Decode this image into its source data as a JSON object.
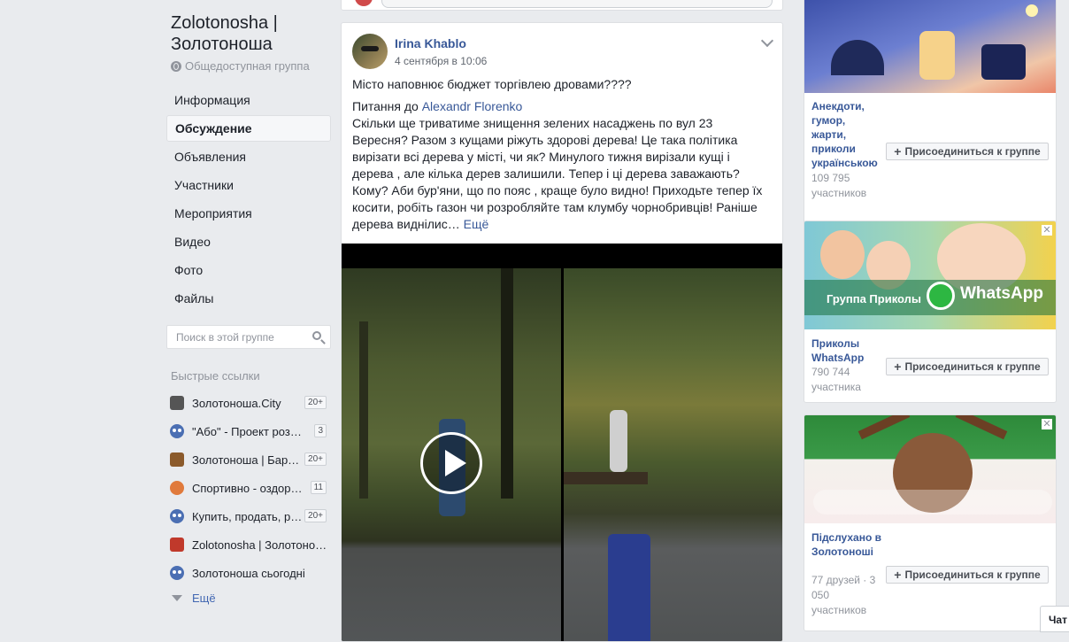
{
  "group": {
    "title": "Zolotonosha | Золотоноша",
    "privacy": "Общедоступная группа"
  },
  "nav": {
    "items": [
      {
        "label": "Информация",
        "active": false
      },
      {
        "label": "Обсуждение",
        "active": true
      },
      {
        "label": "Объявления",
        "active": false
      },
      {
        "label": "Участники",
        "active": false
      },
      {
        "label": "Мероприятия",
        "active": false
      },
      {
        "label": "Видео",
        "active": false
      },
      {
        "label": "Фото",
        "active": false
      },
      {
        "label": "Файлы",
        "active": false
      }
    ]
  },
  "search": {
    "placeholder": "Поиск в этой группе"
  },
  "quick_links": {
    "heading": "Быстрые ссылки",
    "items": [
      {
        "label": "Золотоноша.City",
        "badge": "20+",
        "icon": "city-icon",
        "icon_color": "#555555"
      },
      {
        "label": "\"Або\" - Проект розв…",
        "badge": "3",
        "icon": "group-icon",
        "icon_color": "#4b6fb3"
      },
      {
        "label": "Золотоноша | Бар…",
        "badge": "20+",
        "icon": "briefcase-icon",
        "icon_color": "#8b5a2b"
      },
      {
        "label": "Спортивно - оздоро…",
        "badge": "11",
        "icon": "ball-icon",
        "icon_color": "#e07a3c"
      },
      {
        "label": "Купить, продать, р…",
        "badge": "20+",
        "icon": "group-icon",
        "icon_color": "#4b6fb3"
      },
      {
        "label": "Zolotonosha | Золотоно…",
        "badge": "",
        "icon": "house-icon",
        "icon_color": "#c0392b"
      },
      {
        "label": "Золотоноша сьогодні",
        "badge": "",
        "icon": "group-icon",
        "icon_color": "#4b6fb3"
      }
    ],
    "more_label": "Ещё"
  },
  "post": {
    "author": "Irina Khablo",
    "timestamp": "4 сентября в 10:06",
    "line1": "Місто наповнює бюджет торгівлею дровами????",
    "line2_prefix": "Питання до ",
    "line2_mention": "Alexandr Florenko",
    "body": "Скільки ще триватиме знищення зелених насаджень по вул 23 Вересня? Разом з кущами ріжуть здорові дерева! Це така політика вирізати всі дерева у місті, чи як? Минулого тижня вирізали кущі і дерева , але кілька дерев залишили. Тепер і ці дерева заважають? Кому? Аби бур'яни, що по пояс , краще було видно! Приходьте тепер їх косити, робіть газон чи розробляйте там клумбу чорнобривців! Раніше дерева виднілис…",
    "see_more": "Ещё"
  },
  "ads": [
    {
      "name": "Анекдоти, гумор, жарти, приколи українською",
      "meta": "109 795 участников",
      "join": "Присоединиться к группе"
    },
    {
      "name": "Приколы WhatsApp",
      "meta": "790 744 участника",
      "join": "Присоединиться к группе",
      "banner_left": "Группа Приколы",
      "banner_right": "WhatsApp"
    },
    {
      "name": "Підслухано в Золотоноші",
      "meta": "77 друзей · 3 050 участников",
      "join": "Присоединиться к группе"
    }
  ],
  "chat": {
    "label": "Чат"
  },
  "colors": {
    "background": "#e9ebee",
    "link": "#385898",
    "accent": "#4267b2",
    "whatsapp_green": "#2db742"
  }
}
